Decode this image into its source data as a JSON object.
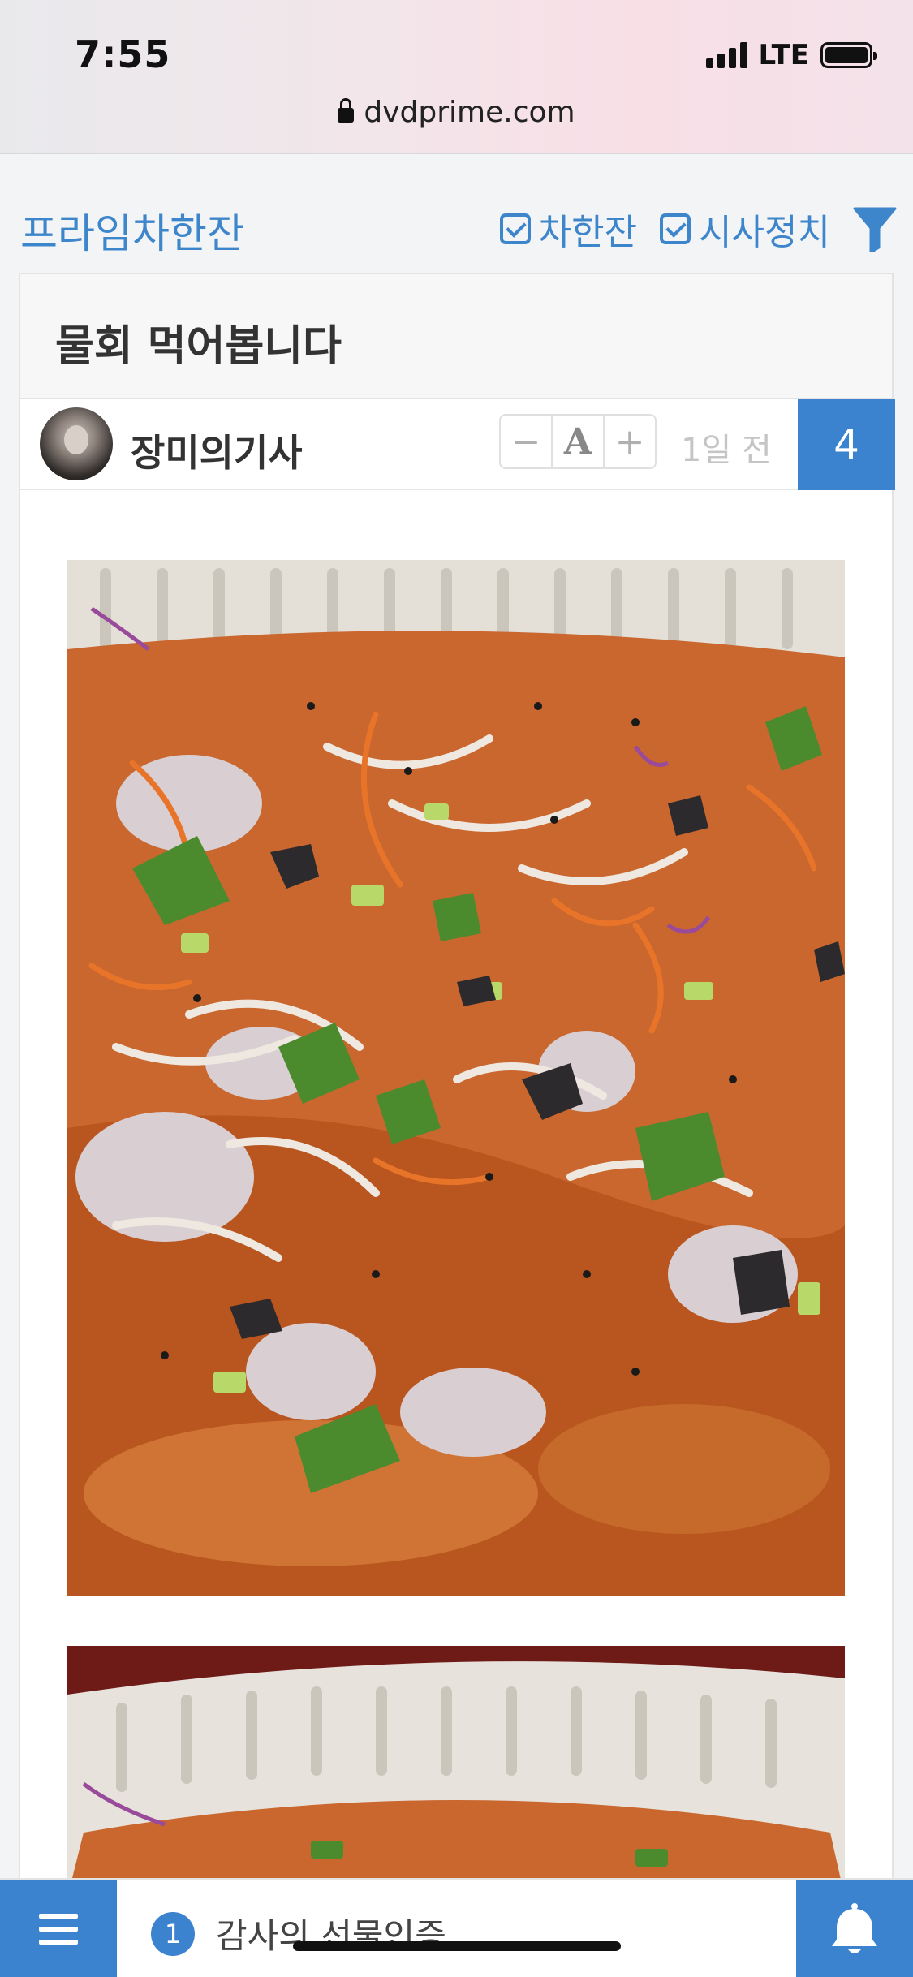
{
  "status_bar": {
    "time": "7:55",
    "network": "LTE"
  },
  "browser": {
    "url": "dvdprime.com"
  },
  "board": {
    "title": "프라임차한잔",
    "filters": [
      {
        "label": "차한잔",
        "checked": true
      },
      {
        "label": "시사정치",
        "checked": true
      }
    ]
  },
  "post": {
    "title": "물회 먹어봅니다",
    "author": "장미의기사",
    "font_controls": {
      "decrease": "−",
      "font": "A",
      "increase": "+"
    },
    "time_ago": "1일 전",
    "comment_count": "4"
  },
  "bottom_bar": {
    "notice_badge": "1",
    "notice_text": "감사의 선물인증"
  },
  "colors": {
    "accent": "#3b82cf",
    "title_blue": "#3e86cc"
  }
}
